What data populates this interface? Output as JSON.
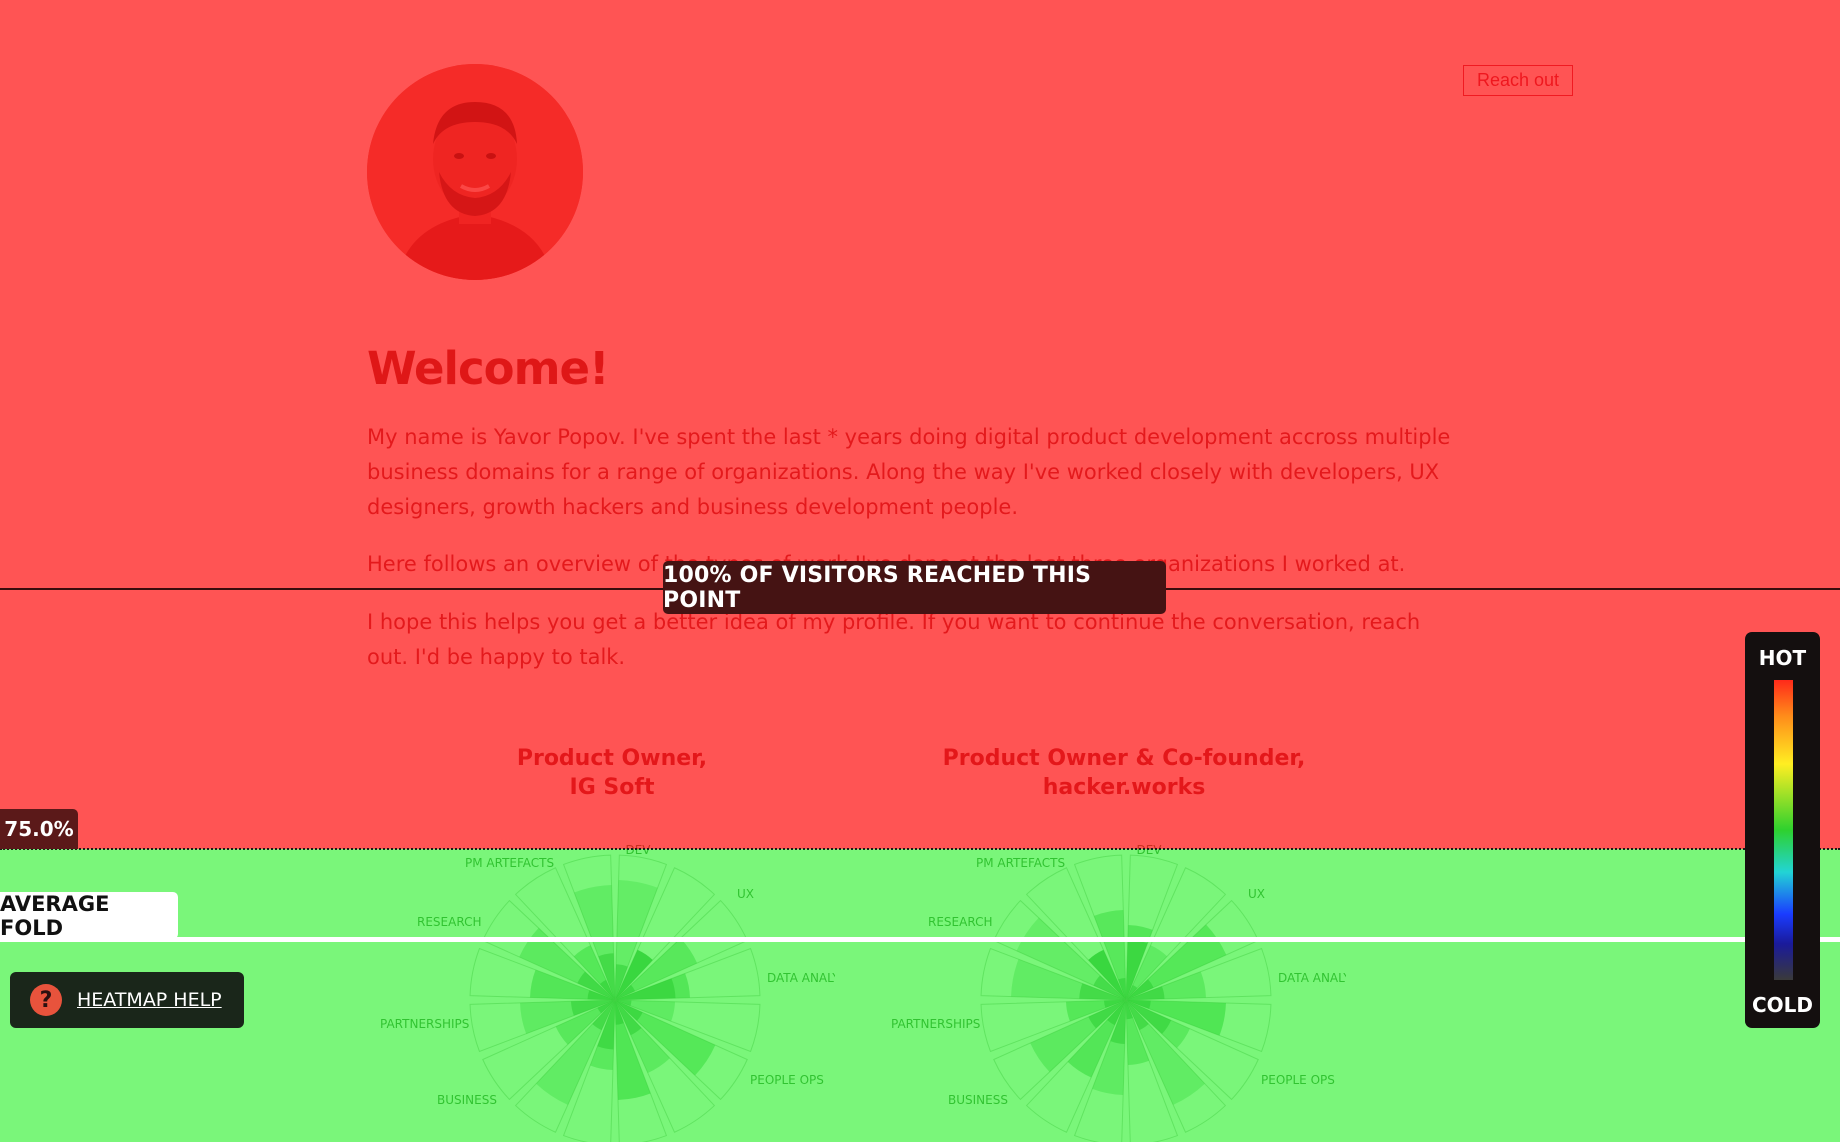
{
  "header": {
    "cta_label": "Reach out"
  },
  "intro": {
    "heading": "Welcome!",
    "paragraph_1": "My name is Yavor Popov. I've spent the last * years doing digital product development accross multiple business domains for a range of organizations. Along the way I've worked closely with developers, UX designers, growth hackers and business development people.",
    "paragraph_2": "Here follows an overview of the types of work I've done at the last three organizations I worked at.",
    "paragraph_3": "I hope this helps you get a better idea of my profile. If you want to continue the conversation, reach out. I'd be happy to talk."
  },
  "roles": [
    {
      "line1": "Product Owner,",
      "line2": "IG Soft"
    },
    {
      "line1": "Product Owner & Co-founder,",
      "line2": "hacker.works"
    }
  ],
  "skill_axes": [
    "DEV",
    "UX",
    "DATA ANALYTICS",
    "PEOPLE OPS",
    "BUSINESS",
    "PARTNERSHIPS",
    "RESEARCH",
    "PM ARTEFACTS"
  ],
  "heatmap": {
    "reach_line_label": "100% OF VISITORS REACHED THIS POINT",
    "scroll_marker_label": "75.0%",
    "fold_label": "AVERAGE FOLD",
    "help_label": "HEATMAP HELP",
    "help_icon": "question-icon",
    "legend_hot": "HOT",
    "legend_cold": "COLD",
    "hot_zone_color": "#ff1414",
    "cold_zone_color": "#28f028"
  }
}
